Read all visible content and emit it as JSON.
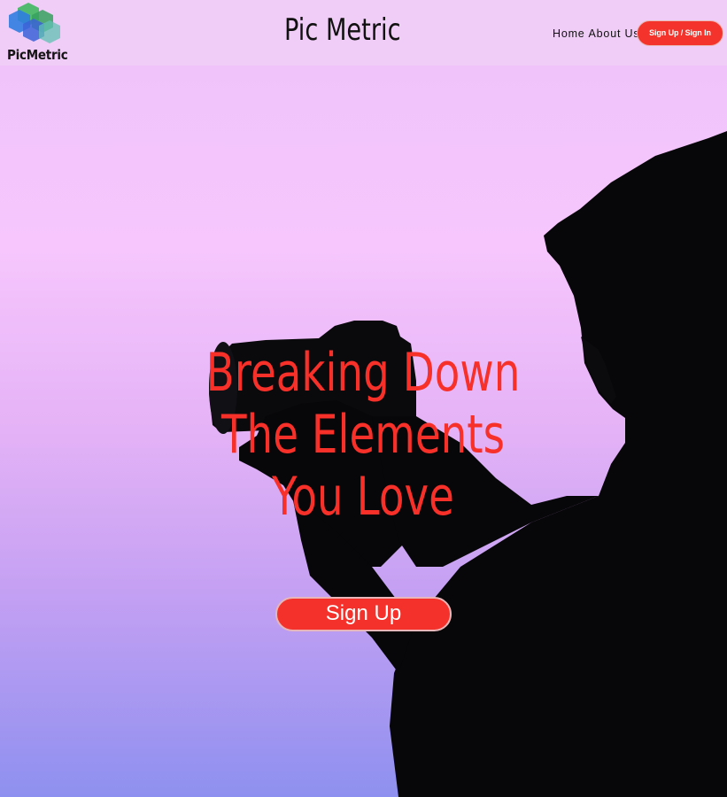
{
  "header": {
    "logo_text": "PicMetric",
    "site_title": "Pic Metric",
    "nav": [
      {
        "label": "Home"
      },
      {
        "label": "About Us"
      }
    ],
    "auth_button": "Sign Up / Sign In"
  },
  "hero": {
    "headline_lines": [
      "Breaking Down",
      "The Elements",
      "You Love"
    ],
    "cta_label": "Sign Up",
    "image": "silhouette-photographer-with-camera"
  },
  "colors": {
    "accent": "#f4342c",
    "header_bg": "#f0cdf7",
    "hero_top": "#f6c6fd",
    "hero_bottom": "#8e90ef"
  },
  "icons": [
    "picmetric-logo-icon"
  ]
}
